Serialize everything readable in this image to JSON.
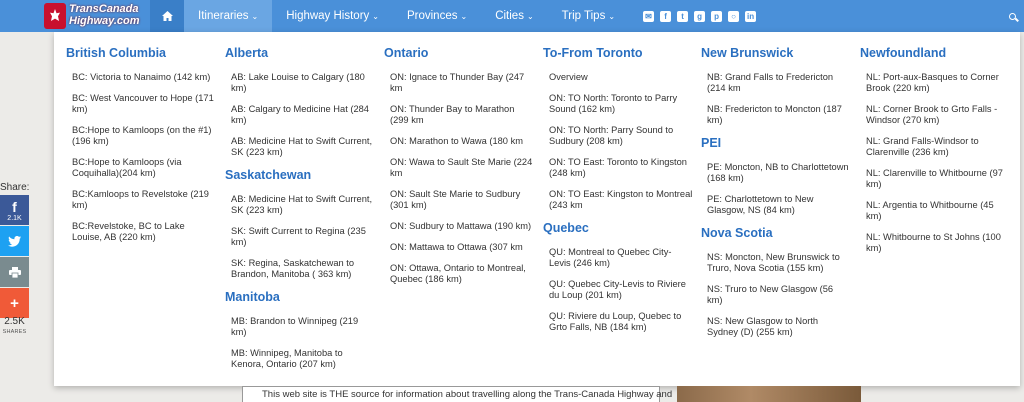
{
  "logo": {
    "line1": "TransCanada",
    "line2": "Highway.com"
  },
  "nav": {
    "items": [
      {
        "label": "Itineraries",
        "name": "nav-itineraries"
      },
      {
        "label": "Highway History",
        "name": "nav-highway-history"
      },
      {
        "label": "Provinces",
        "name": "nav-provinces"
      },
      {
        "label": "Cities",
        "name": "nav-cities"
      },
      {
        "label": "Trip Tips",
        "name": "nav-trip-tips"
      }
    ],
    "social_icons": [
      "email-icon",
      "facebook-icon",
      "twitter-icon",
      "google-plus-icon",
      "pinterest-icon",
      "instagram-icon",
      "linkedin-icon"
    ]
  },
  "columns": [
    {
      "sections": [
        {
          "title": "British Columbia",
          "routes": [
            "BC: Victoria to Nanaimo (142 km)",
            "BC: West Vancouver to Hope (171 km)",
            "BC:Hope to Kamloops (on the #1) (196 km)",
            "BC:Hope to Kamloops (via Coquihalla)(204 km)",
            "BC:Kamloops to Revelstoke (219 km)",
            "BC:Revelstoke, BC to Lake Louise, AB (220 km)"
          ]
        }
      ]
    },
    {
      "sections": [
        {
          "title": "Alberta",
          "routes": [
            "AB: Lake Louise to Calgary (180 km)",
            "AB: Calgary to Medicine Hat (284 km)",
            "AB: Medicine Hat to Swift Current, SK (223 km)"
          ]
        },
        {
          "title": "Saskatchewan",
          "routes": [
            "AB: Medicine Hat to Swift Current, SK (223 km)",
            "SK: Swift Current to Regina (235 km)",
            "SK: Regina, Saskatchewan to Brandon, Manitoba ( 363 km)"
          ]
        },
        {
          "title": "Manitoba",
          "routes": [
            "MB: Brandon to Winnipeg (219 km)",
            "MB: Winnipeg, Manitoba to Kenora, Ontario (207 km)"
          ]
        }
      ]
    },
    {
      "sections": [
        {
          "title": "Ontario",
          "routes": [
            "ON: Ignace to Thunder Bay (247 km",
            "ON: Thunder Bay to Marathon (299 km",
            "ON: Marathon to Wawa (180 km",
            "ON: Wawa to Sault Ste Marie (224 km",
            "ON: Sault Ste Marie to Sudbury (301 km)",
            "ON: Sudbury to Mattawa (190 km)",
            "ON: Mattawa to Ottawa (307 km",
            "ON: Ottawa, Ontario to Montreal, Quebec (186 km)"
          ]
        }
      ]
    },
    {
      "sections": [
        {
          "title": "To-From Toronto",
          "routes": [
            "Overview",
            "ON: TO North: Toronto to Parry Sound (162 km)",
            "ON: TO North: Parry Sound to Sudbury (208 km)",
            "ON: TO East: Toronto to Kingston (248 km)",
            "ON: TO East: Kingston to Montreal (243 km"
          ]
        },
        {
          "title": "Quebec",
          "routes": [
            "QU: Montreal to Quebec City-Levis (246 km)",
            "QU: Quebec City-Levis to Riviere du Loup (201 km)",
            "QU: Riviere du Loup, Quebec to Grto Falls, NB (184 km)"
          ]
        }
      ]
    },
    {
      "sections": [
        {
          "title": "New Brunswick",
          "routes": [
            "NB: Grand Falls to Fredericton (214 km",
            "NB: Fredericton to Moncton (187 km)"
          ]
        },
        {
          "title": "PEI",
          "routes": [
            "PE: Moncton, NB to Charlottetown (168 km)",
            "PE: Charlottetown to New Glasgow, NS (84 km)"
          ]
        },
        {
          "title": "Nova Scotia",
          "routes": [
            "NS: Moncton, New Brunswick to Truro, Nova Scotia (155 km)",
            "NS: Truro to New Glasgow (56 km)",
            "NS: New Glasgow to North Sydney (D) (255 km)"
          ]
        }
      ]
    },
    {
      "sections": [
        {
          "title": "Newfoundland",
          "routes": [
            "NL: Port-aux-Basques to Corner Brook (220 km)",
            "NL: Corner Brook to Grto Falls - Windsor (270 km)",
            "NL: Grand Falls-Windsor to Clarenville (236 km)",
            "NL: Clarenville to Whitbourne (97 km)",
            "NL: Argentia to Whitbourne (45 km)",
            "NL: Whitbourne to St Johns (100 km)"
          ]
        }
      ]
    }
  ],
  "share": {
    "label": "Share:",
    "facebook_count": "2.1K",
    "total": "2.5K",
    "total_label": "SHARES"
  },
  "content": {
    "intro": "This web site is THE source for information about travelling along the Trans-Canada Highway and"
  }
}
